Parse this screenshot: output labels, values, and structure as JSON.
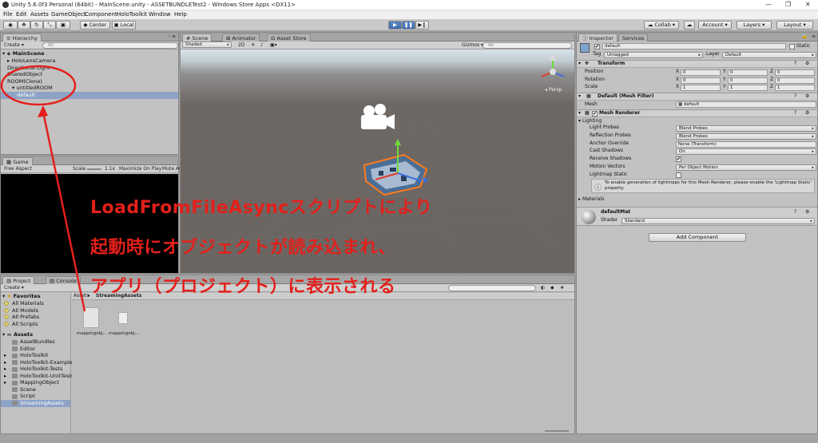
{
  "window": {
    "title": "Unity 5.6.0f3 Personal (64bit) - MainScene.unity - ASSETBUNDLETest2 - Windows Store Apps <DX11>",
    "controls": [
      "—",
      "❐",
      "✕"
    ]
  },
  "menu": [
    "File",
    "Edit",
    "Assets",
    "GameObject",
    "Component",
    "HoloToolkit",
    "Window",
    "Help"
  ],
  "toolbar": {
    "pivot": "Center",
    "space": "Local",
    "collab": "Collab ▾",
    "account": "Account ▾",
    "layers": "Layers ▾",
    "layout": "Layout ▾"
  },
  "hierarchy": {
    "tab": "Hierarchy",
    "create": "Create ▾",
    "search_placeholder": "All",
    "scene": "MainScene",
    "items": [
      {
        "label": "HoloLensCamera",
        "indent": 1,
        "arrow": "▸"
      },
      {
        "label": "Directional Light",
        "indent": 1,
        "arrow": ""
      },
      {
        "label": "SharedObject",
        "indent": 1,
        "arrow": ""
      },
      {
        "label": "ROOM(Clone)",
        "indent": 1,
        "arrow": ""
      },
      {
        "label": "untitledROOM",
        "indent": 2,
        "arrow": "▾"
      },
      {
        "label": "default",
        "indent": 3,
        "arrow": "",
        "selected": true
      }
    ]
  },
  "scene": {
    "tabs": [
      "Scene",
      "Animator",
      "Asset Store"
    ],
    "shading": "Shaded",
    "mode2d": "2D",
    "gizmos": "Gizmos ▾",
    "search_placeholder": "All",
    "persp": "Persp"
  },
  "game": {
    "tab": "Game",
    "aspect": "Free Aspect",
    "scale_label": "Scale",
    "scale_value": "1.1x",
    "maximize": "Maximize On Play",
    "mute": "Mute Au"
  },
  "project": {
    "tabs": [
      "Project",
      "Console"
    ],
    "create": "Create ▾",
    "favorites_title": "Favorites",
    "favorites": [
      "All Materials",
      "All Models",
      "All Prefabs",
      "All Scripts"
    ],
    "assets_title": "Assets",
    "folders": [
      {
        "label": "AssetBundles",
        "arrow": ""
      },
      {
        "label": "Editor",
        "arrow": ""
      },
      {
        "label": "HoloToolkit",
        "arrow": "▸"
      },
      {
        "label": "HoloToolkit-Examples",
        "arrow": "▸"
      },
      {
        "label": "HoloToolkit-Tests",
        "arrow": "▸"
      },
      {
        "label": "HoloToolkit-UnitTests",
        "arrow": "▸"
      },
      {
        "label": "MappingObject",
        "arrow": "▸"
      },
      {
        "label": "Scene",
        "arrow": ""
      },
      {
        "label": "Script",
        "arrow": ""
      },
      {
        "label": "StreamingAssets",
        "arrow": "",
        "selected": true
      }
    ],
    "breadcrumb": [
      "Assets",
      "StreamingAssets"
    ],
    "files": [
      "mappingobj...",
      "mappingobj..."
    ]
  },
  "inspector": {
    "tabs": [
      "Inspector",
      "Services"
    ],
    "object_name": "default",
    "static_label": "Static",
    "tag_label": "Tag",
    "tag_value": "Untagged",
    "layer_label": "Layer",
    "layer_value": "Default",
    "transform_title": "Transform",
    "transform_rows": [
      {
        "label": "Position",
        "x": "0",
        "y": "0",
        "z": "0"
      },
      {
        "label": "Rotation",
        "x": "0",
        "y": "0",
        "z": "0"
      },
      {
        "label": "Scale",
        "x": "1",
        "y": "1",
        "z": "1"
      }
    ],
    "axis_labels": [
      "X",
      "Y",
      "Z"
    ],
    "mesh_filter_title": "Default (Mesh Filter)",
    "mesh_label": "Mesh",
    "mesh_value": "default",
    "mesh_renderer_title": "Mesh Renderer",
    "lighting_label": "Lighting",
    "props": [
      {
        "label": "Light Probes",
        "value": "Blend Probes",
        "kind": "dropdown"
      },
      {
        "label": "Reflection Probes",
        "value": "Blend Probes",
        "kind": "dropdown"
      },
      {
        "label": "Anchor Override",
        "value": "None (Transform)",
        "kind": "field"
      },
      {
        "label": "Cast Shadows",
        "value": "On",
        "kind": "dropdown"
      },
      {
        "label": "Receive Shadows",
        "value": "✔",
        "kind": "check"
      },
      {
        "label": "Motion Vectors",
        "value": "Per Object Motion",
        "kind": "dropdown"
      },
      {
        "label": "Lightmap Static",
        "value": "",
        "kind": "check"
      }
    ],
    "info_text": "To enable generation of lightmaps for this Mesh Renderer, please enable the 'Lightmap Static' property.",
    "materials_label": "Materials",
    "material_name": "defaultMat",
    "shader_label": "Shader",
    "shader_value": "Standard",
    "add_component": "Add Component"
  },
  "annotation": {
    "line1": "LoadFromFileAsyncスクリプトにより",
    "line2": "起動時にオブジェクトが読み込まれ、",
    "line3": "アプリ（プロジェクト）に表示される",
    "color": "#e3201b"
  }
}
